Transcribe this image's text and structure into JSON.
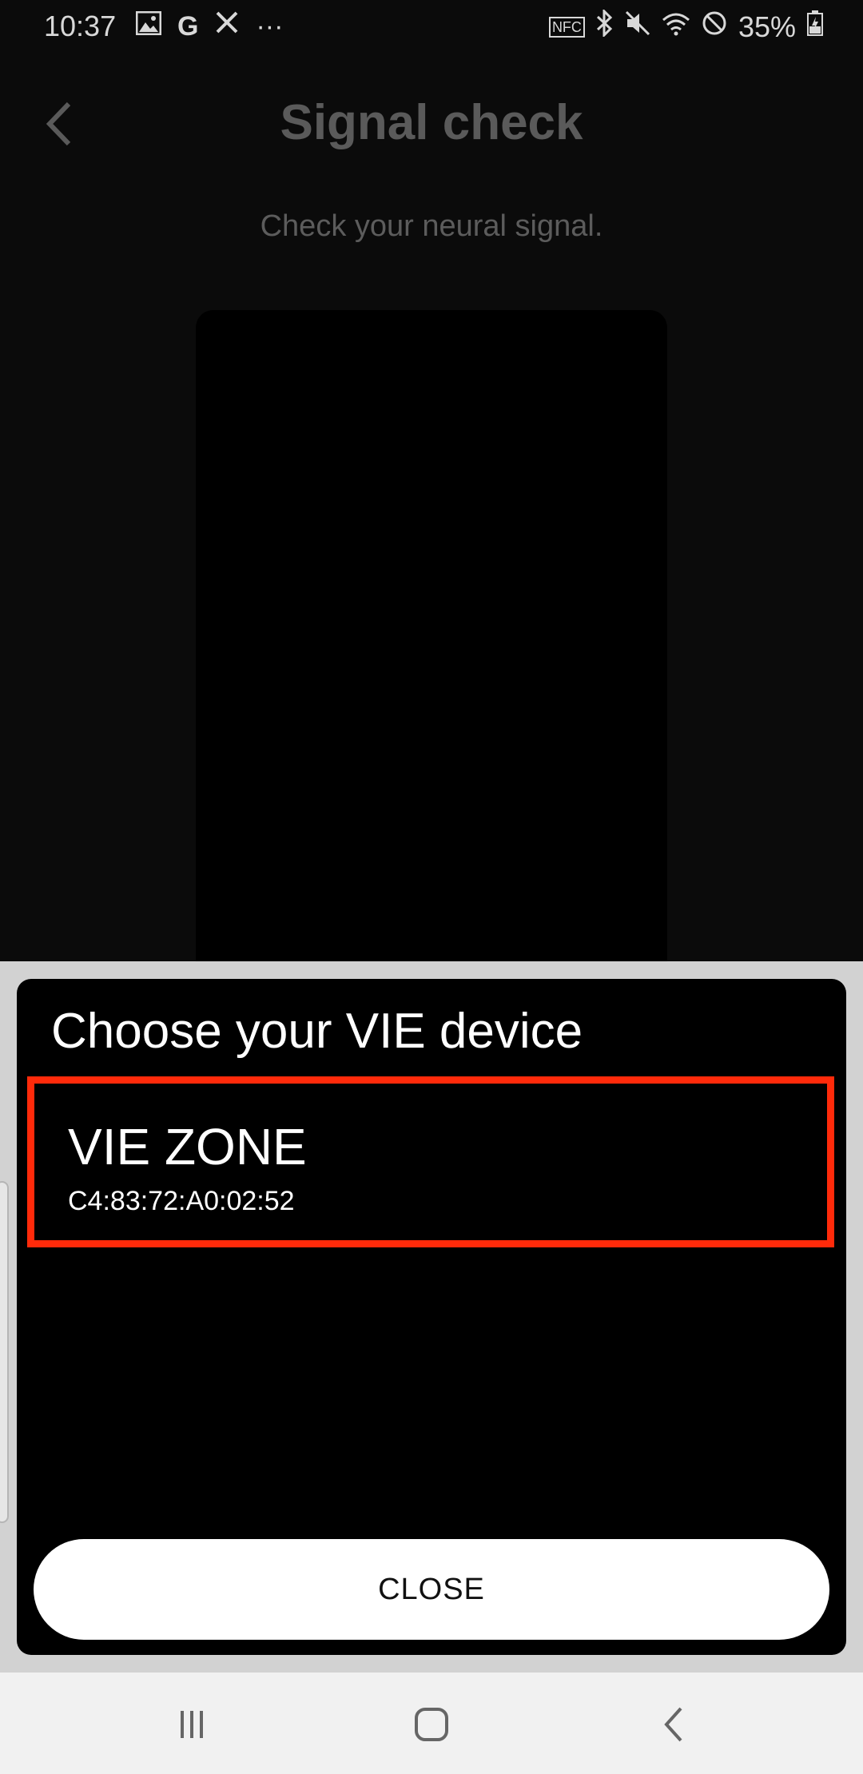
{
  "status_bar": {
    "time": "10:37",
    "left_icons": [
      "gallery-icon",
      "google-icon",
      "tools-icon",
      "more-dots-icon"
    ],
    "right_icons": [
      "nfc-icon",
      "bluetooth-icon",
      "mute-icon",
      "wifi-icon",
      "do-not-disturb-icon"
    ],
    "battery": "35%"
  },
  "header": {
    "title": "Signal check",
    "subtitle": "Check your neural signal."
  },
  "dialog": {
    "title": "Choose your VIE device",
    "devices": [
      {
        "name": "VIE ZONE",
        "address": "C4:83:72:A0:02:52"
      }
    ],
    "close_label": "CLOSE",
    "highlight_color": "#ff2a0a"
  },
  "nav_bar": {
    "buttons": [
      "recent-apps-icon",
      "home-icon",
      "back-icon"
    ]
  }
}
